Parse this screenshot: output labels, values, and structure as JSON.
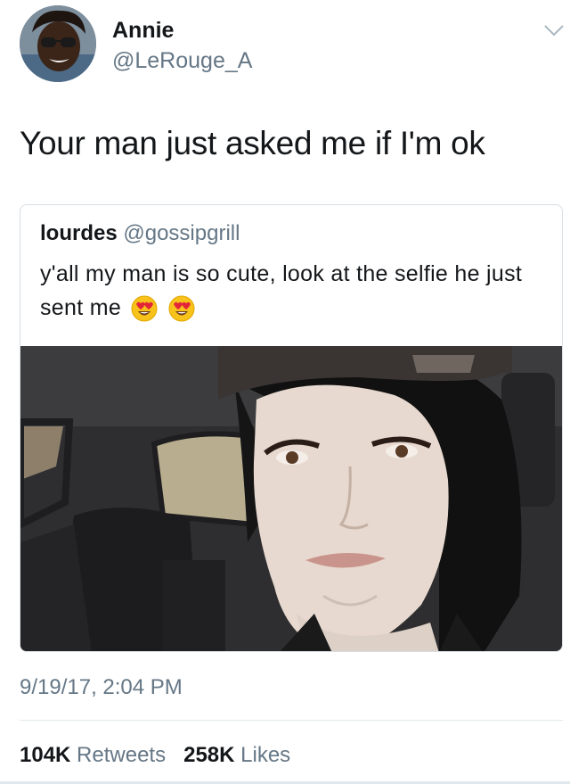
{
  "author": {
    "name": "Annie",
    "handle": "@LeRouge_A",
    "avatar_icon": "avatar-photo"
  },
  "tweet": {
    "text": "Your man just asked me if I'm ok",
    "timestamp": "9/19/17, 2:04 PM"
  },
  "quoted_tweet": {
    "name": "lourdes",
    "handle": "@gossipgrill",
    "text": "y'all my man is so cute, look at the selfie he just sent me",
    "emojis": [
      "heart-eyes-emoji",
      "heart-eyes-emoji"
    ],
    "image": "selfie-photo"
  },
  "stats": {
    "retweets_count": "104K",
    "retweets_label": "Retweets",
    "likes_count": "258K",
    "likes_label": "Likes"
  },
  "colors": {
    "text": "#14171a",
    "secondary": "#657786",
    "border": "#d8dee3"
  }
}
